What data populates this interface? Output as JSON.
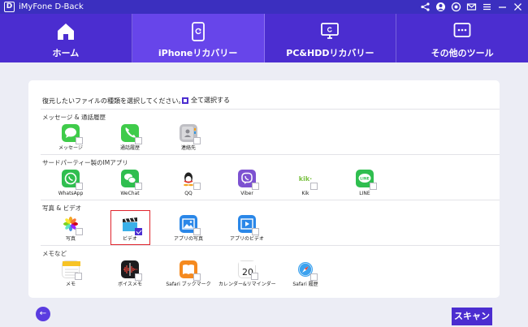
{
  "app": {
    "logo": "D",
    "title": "iMyFone D-Back"
  },
  "titlebar_icons": [
    "share-icon",
    "account-icon",
    "settings-icon",
    "mail-icon",
    "menu-icon",
    "minimize-icon",
    "close-icon"
  ],
  "nav": {
    "tabs": [
      {
        "label": "ホーム",
        "icon": "home-icon"
      },
      {
        "label": "iPhoneリカバリー",
        "icon": "phone-recovery-icon"
      },
      {
        "label": "PC&HDDリカバリー",
        "icon": "pc-recovery-icon"
      },
      {
        "label": "その他のツール",
        "icon": "tools-icon"
      }
    ],
    "active": 1
  },
  "main": {
    "prompt": "復元したいファイルの種類を選択してください。",
    "select_all": "全て選択する",
    "sections": [
      {
        "title": "メッセージ & 通話履歴",
        "items": [
          "メッセージ",
          "通話履歴",
          "連絡先"
        ]
      },
      {
        "title": "サードパーティー製のIMアプリ",
        "items": [
          "WhatsApp",
          "WeChat",
          "QQ",
          "Viber",
          "Kik",
          "LINE"
        ]
      },
      {
        "title": "写真 & ビデオ",
        "items": [
          "写真",
          "ビデオ",
          "アプリの写真",
          "アプリのビデオ"
        ]
      },
      {
        "title": "メモなど",
        "items": [
          "メモ",
          "ボイスメモ",
          "Safari ブックマーク",
          "カレンダー&リマインダー",
          "Safari 履歴"
        ]
      }
    ],
    "icon_text": {
      "kik": "kik·",
      "line": "LINE",
      "calendar_day": "20"
    }
  },
  "colors": {
    "primary": "#4b2dd0",
    "active_tab": "#6745ea",
    "highlight": "#e0242c"
  },
  "footer": {
    "back": "←",
    "scan": "スキャン"
  }
}
